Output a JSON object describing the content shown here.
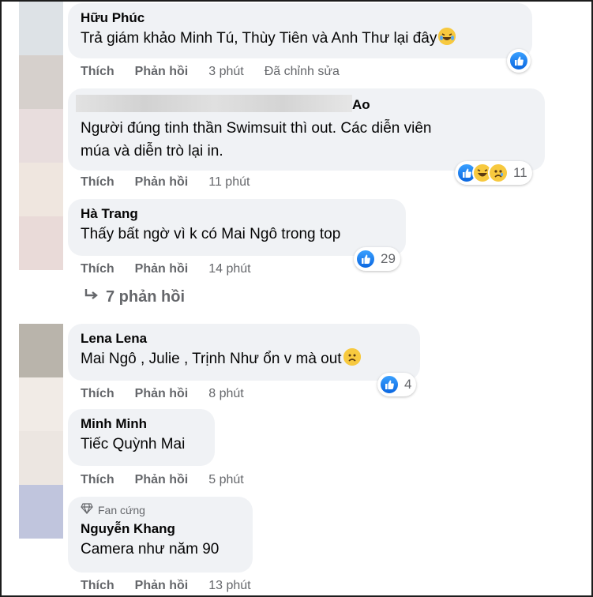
{
  "comments": [
    {
      "name": "Hữu Phúc",
      "text": "Trả giám khảo Minh Tú, Thùy Tiên và Anh Thư lại đây",
      "like_label": "Thích",
      "reply_label": "Phản hồi",
      "time": "3 phút",
      "edited": "Đã chỉnh sửa"
    },
    {
      "name": "Ao",
      "text_line1": "Người đúng tinh thần Swimsuit thì out. Các diễn viên",
      "text_line2": "múa và diễn trò lại in.",
      "like_label": "Thích",
      "reply_label": "Phản hồi",
      "time": "11 phút",
      "reaction_count": "11"
    },
    {
      "name": "Hà Trang",
      "text": "Thấy bất ngờ vì k có Mai Ngô trong top",
      "like_label": "Thích",
      "reply_label": "Phản hồi",
      "time": "14 phút",
      "reaction_count": "29"
    },
    {
      "name": "Lena Lena",
      "text": "Mai Ngô , Julie , Trịnh Như ổn v mà out",
      "like_label": "Thích",
      "reply_label": "Phản hồi",
      "time": "8 phút",
      "reaction_count": "4"
    },
    {
      "name": "Minh Minh",
      "text": "Tiếc Quỳnh Mai",
      "like_label": "Thích",
      "reply_label": "Phản hồi",
      "time": "5 phút"
    },
    {
      "badge": "Fan cứng",
      "name": "Nguyễn Khang",
      "text": "Camera như năm 90",
      "like_label": "Thích",
      "reply_label": "Phản hồi",
      "time": "13 phút"
    }
  ],
  "replies_link": "7 phản hồi",
  "colors": {
    "bubble": "#f0f2f5",
    "meta": "#65676b",
    "like_blue": "#0a66e0",
    "emoji_yellow": "#f7c93f"
  },
  "icons": [
    "like-icon",
    "haha-icon",
    "sad-icon",
    "reply-arrow-icon",
    "diamond-icon",
    "crying-laugh-emoji",
    "sad-emoji"
  ]
}
